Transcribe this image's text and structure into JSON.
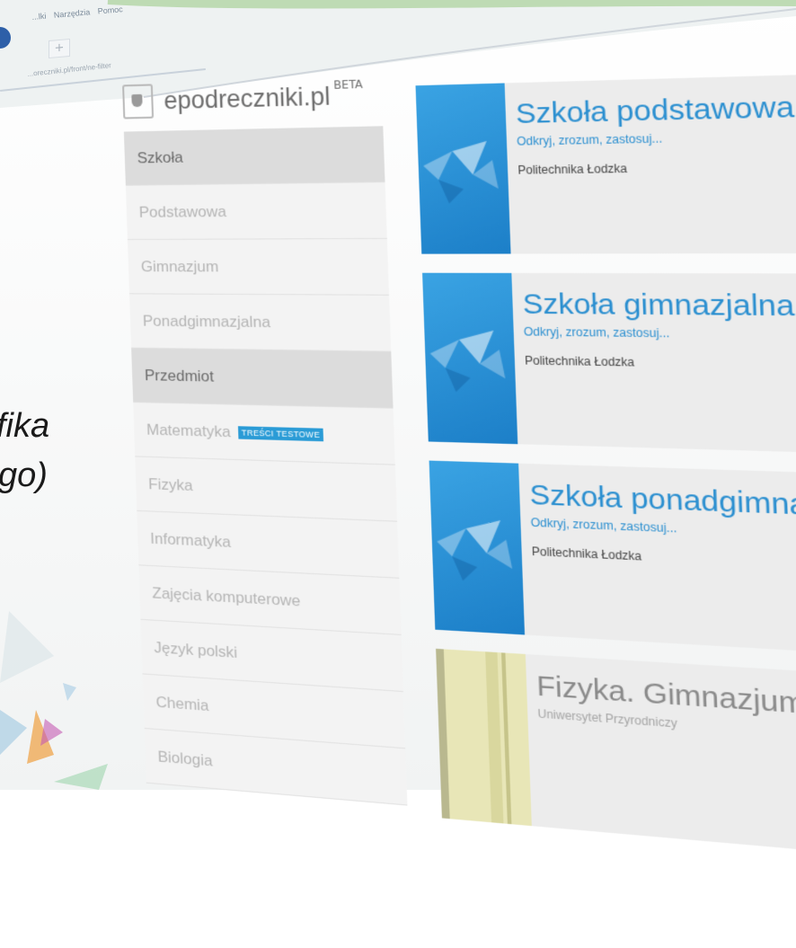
{
  "slide": {
    "text_lines": [
      "fika",
      "go)"
    ],
    "accent_color": "#2b8fd0",
    "brand_color": "#2d5fa8"
  },
  "browser": {
    "menu_items": [
      "...lki",
      "Narzędzia",
      "Pomoc"
    ],
    "new_tab_label": "+",
    "url_text": "...oreczniki.pl/front/ne-filter"
  },
  "app": {
    "logo_icon": "book-shield-icon",
    "name": "epodreczniki.pl",
    "badge": "BETA"
  },
  "sidebar": {
    "items": [
      {
        "label": "Szkoła",
        "type": "header"
      },
      {
        "label": "Podstawowa",
        "type": "option"
      },
      {
        "label": "Gimnazjum",
        "type": "option"
      },
      {
        "label": "Ponadgimnazjalna",
        "type": "option"
      },
      {
        "label": "Przedmiot",
        "type": "header"
      },
      {
        "label": "Matematyka",
        "type": "option",
        "badge": "TREŚCI TESTOWE"
      },
      {
        "label": "Fizyka",
        "type": "option"
      },
      {
        "label": "Informatyka",
        "type": "option"
      },
      {
        "label": "Zajęcia komputerowe",
        "type": "option"
      },
      {
        "label": "Język polski",
        "type": "option"
      },
      {
        "label": "Chemia",
        "type": "option"
      },
      {
        "label": "Biologia",
        "type": "option"
      }
    ]
  },
  "books": [
    {
      "title": "Szkoła podstawowa - Matema",
      "subtitle": "Odkryj, zrozum, zastosuj...",
      "author": "Politechnika Łodzka",
      "cover": "blue"
    },
    {
      "title": "Szkoła gimnazjalna - Matemat",
      "subtitle": "Odkryj, zrozum, zastosuj...",
      "author": "Politechnika Łodzka",
      "cover": "blue"
    },
    {
      "title": "Szkoła ponadgimnazjalna - Ma",
      "subtitle": "Odkryj, zrozum, zastosuj...",
      "author": "Politechnika Łodzka",
      "cover": "blue"
    },
    {
      "title": "Fizyka. Gimnazjum",
      "subtitle": "Uniwersytet Przyrodniczy",
      "author": "",
      "cover": "yellow"
    }
  ]
}
